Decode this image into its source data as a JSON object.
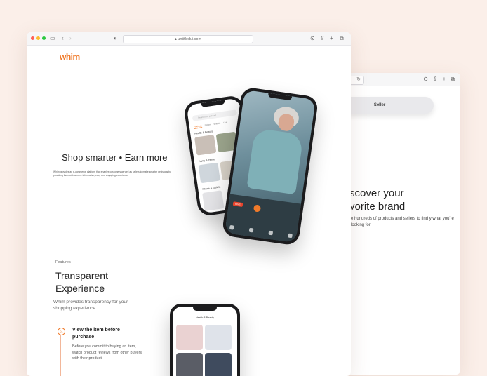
{
  "browser": {
    "url": "untitledui.com"
  },
  "logo": "whim",
  "hero": {
    "title": "Shop smarter • Earn more",
    "subtitle": "Whim provides an e-commerce platform that enables customers as well as sellers to make smarter decisions by providing them with a more informative, easy and engaging experience."
  },
  "phone_left": {
    "search_placeholder": "Search any product",
    "tabs": [
      "Products",
      "Sellers",
      "Brands",
      "Live"
    ],
    "sections": [
      "Health & Beauty",
      "Home & Office",
      "Phone & Tablets"
    ]
  },
  "phone_live": {
    "live_badge": "LIVE"
  },
  "features": {
    "label": "Features",
    "title_line1": "Transparent",
    "title_line2": "Experience",
    "description": "Whim provides transparency for your shopping experience",
    "step_number": "01",
    "step_title": "View the item before purchase",
    "step_description": "Before you commit to buying an item, watch product reviews from other buyers with their product"
  },
  "phone_bottom": {
    "header": "Health & Beauty"
  },
  "second_window": {
    "seller_button": "Seller",
    "discover_line1": "scover your",
    "discover_line2": "vorite brand",
    "discover_sub": "e hundreds of products and sellers to find y what you're looking for"
  },
  "colors": {
    "brand": "#f07a2a",
    "background": "#fbefe9"
  }
}
